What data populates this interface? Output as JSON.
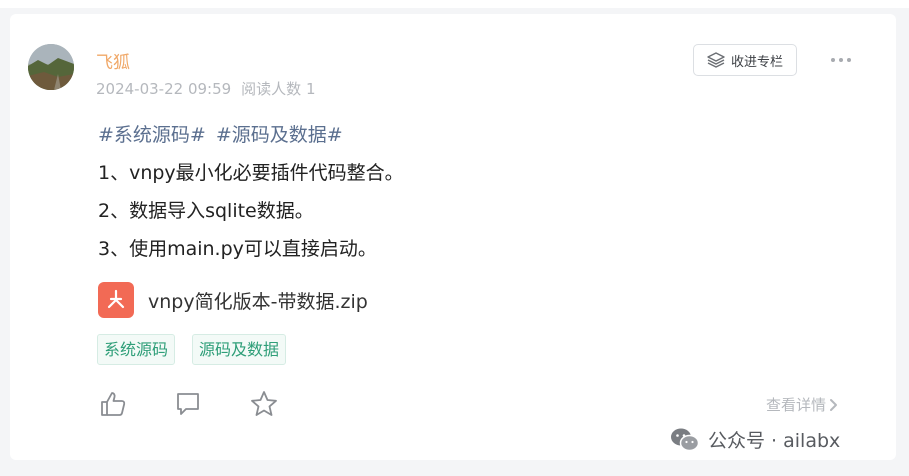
{
  "post": {
    "author": "飞狐",
    "date": "2024-03-22 09:59",
    "reads": "阅读人数 1",
    "collect_label": "收进专栏",
    "hashtags": [
      "#系统源码#",
      "#源码及数据#"
    ],
    "lines": [
      "1、vnpy最小化必要插件代码整合。",
      "2、数据导入sqlite数据。",
      "3、使用main.py可以直接启动。"
    ],
    "attachment": {
      "name": "vnpy简化版本-带数据.zip",
      "color": "#f26a55"
    },
    "tags": [
      "系统源码",
      "源码及数据"
    ],
    "details_label": "查看详情"
  },
  "watermark": {
    "text": "公众号 · ailabx"
  },
  "icons": {
    "collect": "stack-icon",
    "more": "more-dots-icon",
    "like": "thumbs-up-icon",
    "comment": "comment-icon",
    "favorite": "star-icon",
    "chevron": "chevron-right-icon",
    "wechat": "wechat-icon",
    "file": "pdf-file-icon"
  },
  "colors": {
    "author": "#f0a868",
    "hashtag": "#5b6f8f",
    "tag_text": "#2e9e78",
    "muted": "#b5b8bd"
  }
}
